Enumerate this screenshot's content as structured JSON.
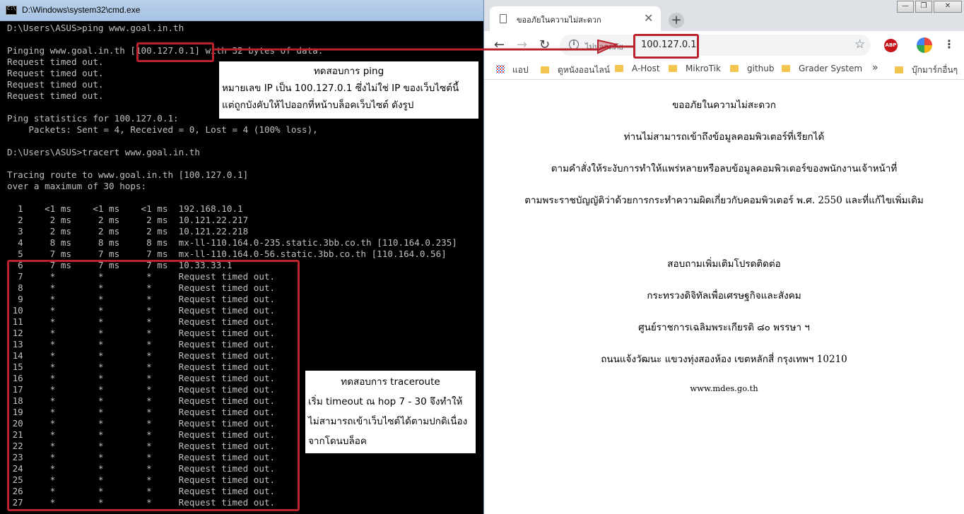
{
  "cmd": {
    "title": "D:\\Windows\\system32\\cmd.exe",
    "lines": [
      "D:\\Users\\ASUS>ping www.goal.in.th",
      "",
      "Pinging www.goal.in.th [100.127.0.1] with 32 bytes of data:",
      "Request timed out.",
      "Request timed out.",
      "Request timed out.",
      "Request timed out.",
      "",
      "Ping statistics for 100.127.0.1:",
      "    Packets: Sent = 4, Received = 0, Lost = 4 (100% loss),",
      "",
      "D:\\Users\\ASUS>tracert www.goal.in.th",
      "",
      "Tracing route to www.goal.in.th [100.127.0.1]",
      "over a maximum of 30 hops:",
      "",
      "  1    <1 ms    <1 ms    <1 ms  192.168.10.1",
      "  2     2 ms     2 ms     2 ms  10.121.22.217",
      "  3     2 ms     2 ms     2 ms  10.121.22.218",
      "  4     8 ms     8 ms     8 ms  mx-ll-110.164.0-235.static.3bb.co.th [110.164.0.235]",
      "  5     7 ms     7 ms     7 ms  mx-ll-110.164.0-56.static.3bb.co.th [110.164.0.56]",
      "  6     7 ms     7 ms     7 ms  10.33.33.1",
      "  7     *        *        *     Request timed out.",
      "  8     *        *        *     Request timed out.",
      "  9     *        *        *     Request timed out.",
      " 10     *        *        *     Request timed out.",
      " 11     *        *        *     Request timed out.",
      " 12     *        *        *     Request timed out.",
      " 13     *        *        *     Request timed out.",
      " 14     *        *        *     Request timed out.",
      " 15     *        *        *     Request timed out.",
      " 16     *        *        *     Request timed out.",
      " 17     *        *        *     Request timed out.",
      " 18     *        *        *     Request timed out.",
      " 19     *        *        *     Request timed out.",
      " 20     *        *        *     Request timed out.",
      " 21     *        *        *     Request timed out.",
      " 22     *        *        *     Request timed out.",
      " 23     *        *        *     Request timed out.",
      " 24     *        *        *     Request timed out.",
      " 25     *        *        *     Request timed out.",
      " 26     *        *        *     Request timed out.",
      " 27     *        *        *     Request timed out."
    ]
  },
  "notes": {
    "ping": {
      "title": "ทดสอบการ ping",
      "line1": "หมายเลข IP เป็น 100.127.0.1 ซึ่งไม่ใช่ IP ของเว็บไซต์นี้",
      "line2": "แต่ถูกบังคับให้ไปออกที่หน้าบล็อคเว็บไซต์ ดังรูป"
    },
    "trace": {
      "title": "ทดสอบการ traceroute",
      "line1": "เริ่ม timeout ณ hop 7 - 30 จึงทำให้",
      "line2": "ไม่สามารถเข้าเว็บไซต์ได้ตามปกติเนื่อง",
      "line3": "จากโดนบล็อค"
    }
  },
  "browser": {
    "tab_title": "ขออภัยในความไม่สะดวก",
    "tab_close": "✕",
    "new_tab": "+",
    "security_label": "ไม่ปลอดภัย",
    "url": "100.127.0.1",
    "window_buttons": {
      "min": "—",
      "max": "❐",
      "close": "✕"
    },
    "bookmarks": {
      "apps": "แอป",
      "items": [
        "ดูหนังออนไลน์",
        "A-Host",
        "MikroTik",
        "github",
        "Grader System"
      ],
      "overflow": "»",
      "other": "บุ๊กมาร์กอื่นๆ"
    },
    "page_lines": [
      "ขออภัยในความไม่สะดวก",
      "ท่านไม่สามารถเข้าถึงข้อมูลคอมพิวเตอร์ที่เรียกได้",
      "ตามคำสั่งให้ระงับการทำให้แพร่หลายหรือลบข้อมูลคอมพิวเตอร์ของพนักงานเจ้าหน้าที่",
      "ตามพระราชบัญญัติว่าด้วยการกระทำความผิดเกี่ยวกับคอมพิวเตอร์ พ.ศ. 2550 และที่แก้ไขเพิ่มเติม",
      "สอบถามเพิ่มเติมโปรดติดต่อ",
      "กระทรวงดิจิทัลเพื่อเศรษฐกิจและสังคม",
      "ศูนย์ราชการเฉลิมพระเกียรติ ๘๐ พรรษา ฯ",
      "ถนนแจ้งวัฒนะ แขวงทุ่งสองห้อง เขตหลักสี่ กรุงเทพฯ 10210",
      "www.mdes.go.th"
    ]
  },
  "colors": {
    "annotation_red": "#b8232e",
    "cmd_text": "#c0c0c0",
    "folder": "#f3c54e"
  }
}
